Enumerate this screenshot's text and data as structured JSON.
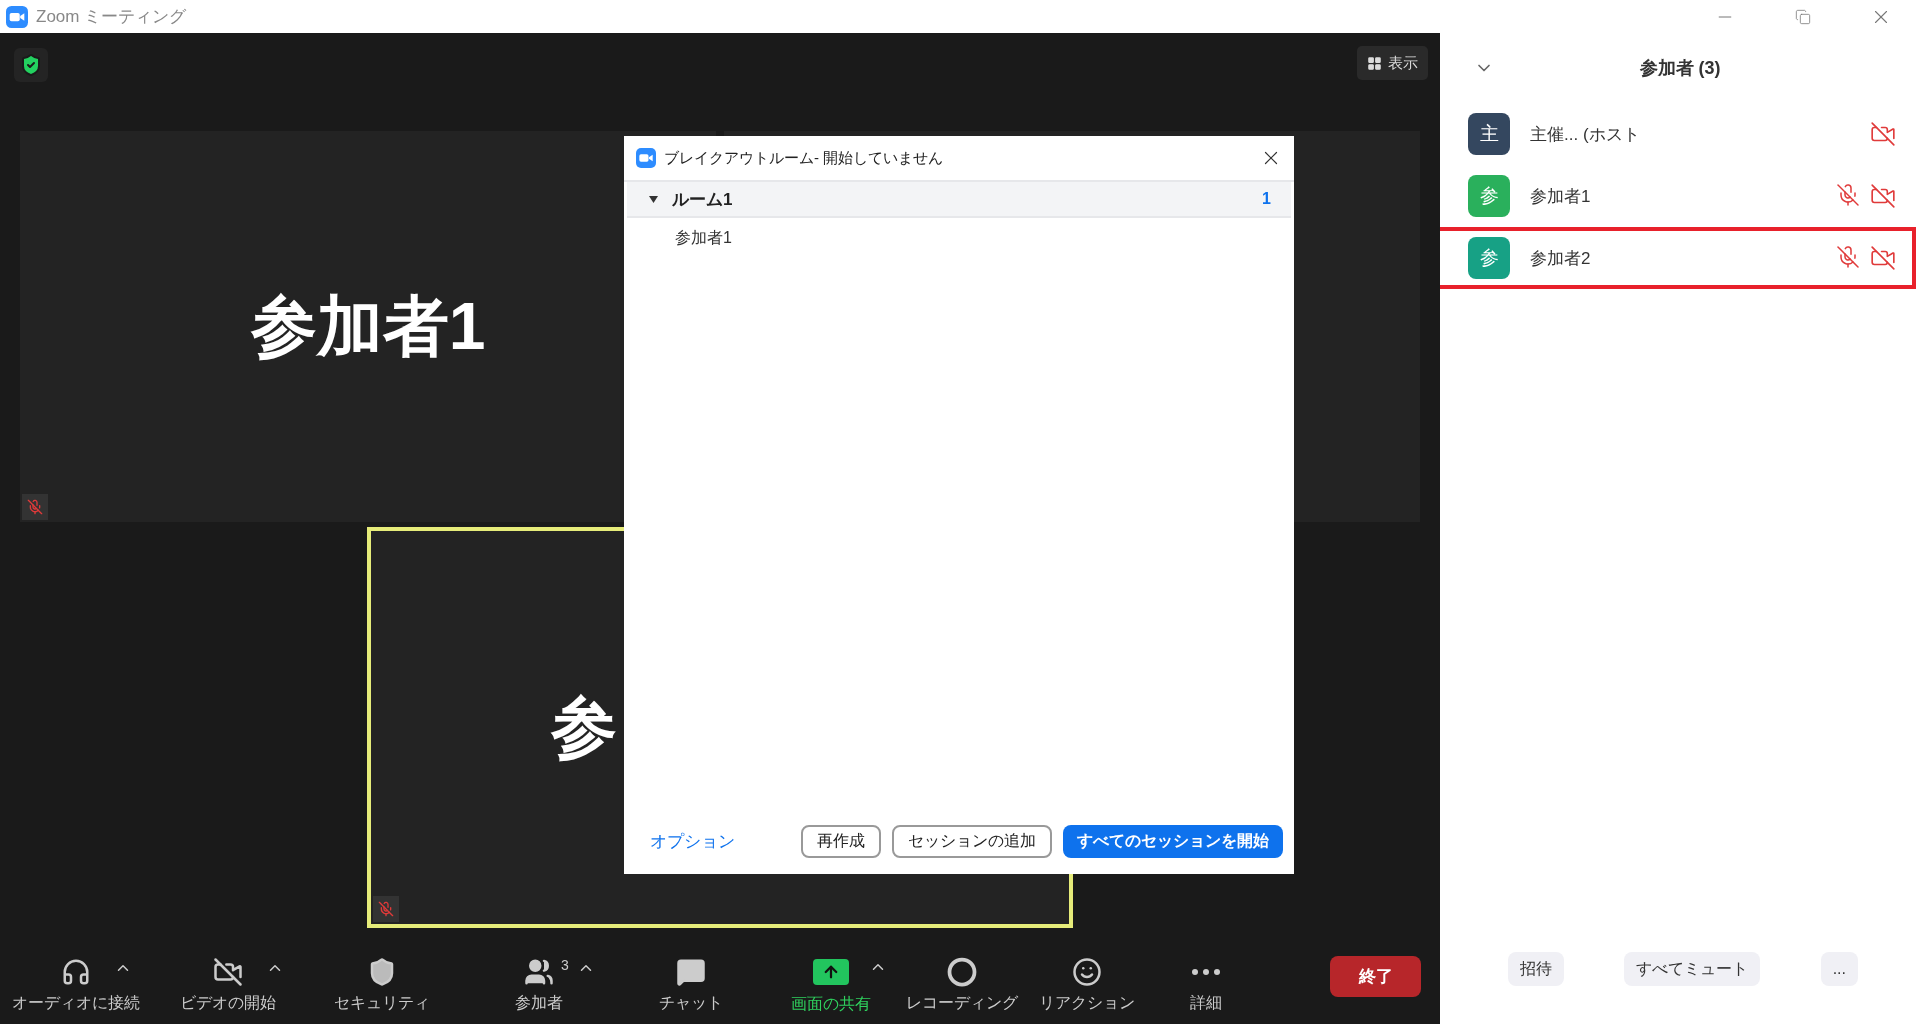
{
  "window": {
    "title": "Zoom ミーティング"
  },
  "view_button": {
    "label": "表示"
  },
  "video_tiles": [
    {
      "name": "参加者1",
      "muted": true,
      "speaking": false
    },
    {
      "name": "参",
      "muted": true,
      "speaking": true
    }
  ],
  "breakout_dialog": {
    "title": "ブレイクアウトルーム- 開始していません",
    "rooms": [
      {
        "name": "ルーム1",
        "count": "1",
        "expanded": true,
        "participants": [
          "参加者1"
        ]
      }
    ],
    "options_link": "オプション",
    "buttons": [
      {
        "label": "再作成",
        "kind": "outline"
      },
      {
        "label": "セッションの追加",
        "kind": "outline"
      },
      {
        "label": "すべてのセッションを開始",
        "kind": "primary"
      }
    ]
  },
  "toolbar": {
    "items": [
      {
        "label": "オーディオに接続",
        "has_menu": true,
        "highlighted": false
      },
      {
        "label": "ビデオの開始",
        "has_menu": true,
        "highlighted": false
      },
      {
        "label": "セキュリティ",
        "has_menu": false,
        "highlighted": false
      },
      {
        "label": "参加者",
        "badge": "3",
        "has_menu": true,
        "highlighted": false
      },
      {
        "label": "チャット",
        "has_menu": false,
        "highlighted": false
      },
      {
        "label": "画面の共有",
        "has_menu": true,
        "highlighted": true
      },
      {
        "label": "レコーディング",
        "has_menu": false,
        "highlighted": false
      },
      {
        "label": "リアクション",
        "has_menu": false,
        "highlighted": false
      },
      {
        "label": "詳細",
        "has_menu": false,
        "highlighted": false
      }
    ],
    "end_button": "終了"
  },
  "participants_panel": {
    "title": "参加者 (3)",
    "participants": [
      {
        "initial": "主",
        "name": "主催... (ホスト",
        "color": "#34475f",
        "muted": false,
        "video_off": true,
        "selected": false
      },
      {
        "initial": "参",
        "name": "参加者1",
        "color": "#2ab05c",
        "muted": true,
        "video_off": true,
        "selected": false
      },
      {
        "initial": "参",
        "name": "参加者2",
        "color": "#17a185",
        "muted": true,
        "video_off": true,
        "selected": true
      }
    ],
    "buttons": [
      "招待",
      "すべてミュート",
      "..."
    ]
  }
}
